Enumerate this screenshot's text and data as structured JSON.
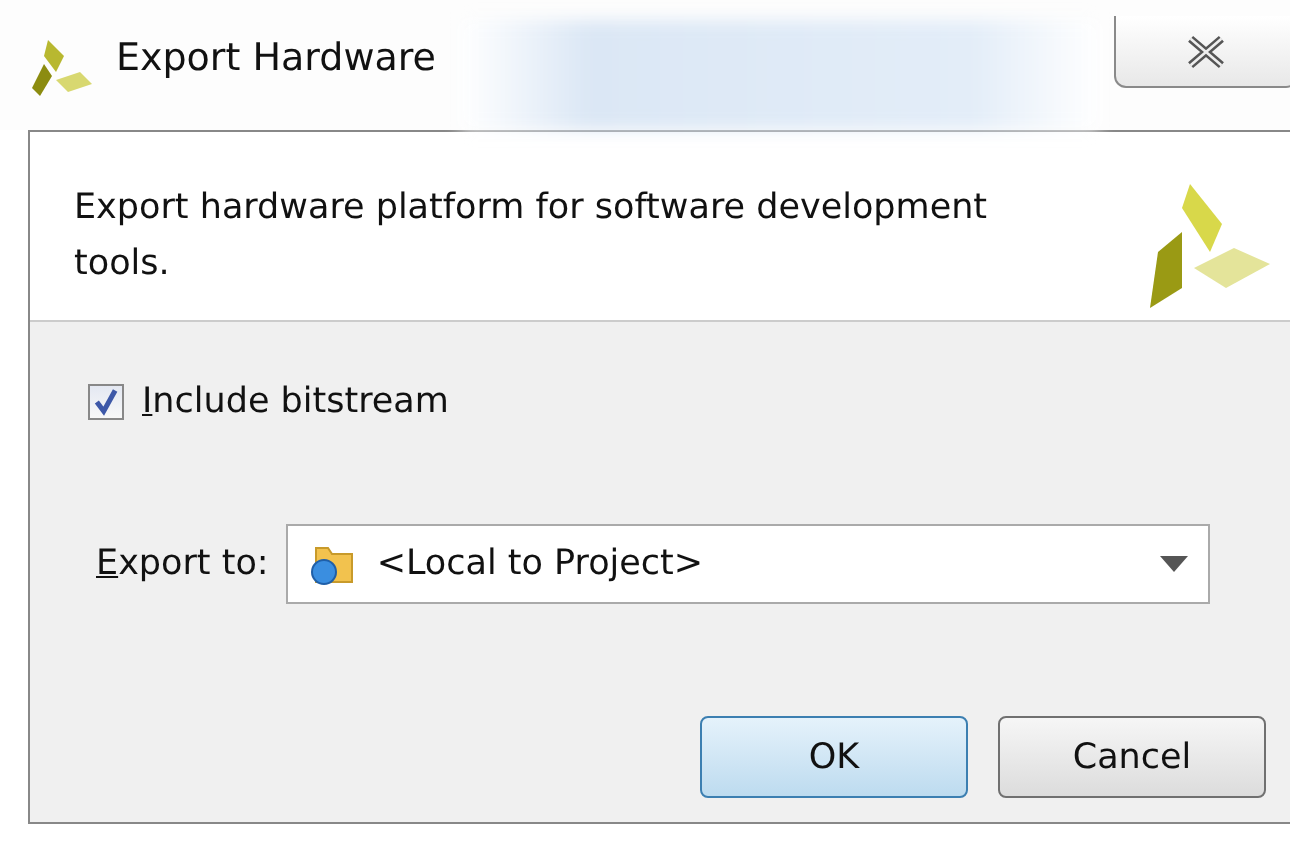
{
  "window": {
    "title": "Export Hardware"
  },
  "header": {
    "description": "Export hardware platform for software development tools."
  },
  "include_bitstream": {
    "label": "Include bitstream",
    "checked": true
  },
  "export_to": {
    "label": "Export to:",
    "value": "<Local to Project>"
  },
  "buttons": [
    {
      "label": "OK",
      "kind": "default"
    },
    {
      "label": "Cancel",
      "kind": "normal"
    }
  ]
}
